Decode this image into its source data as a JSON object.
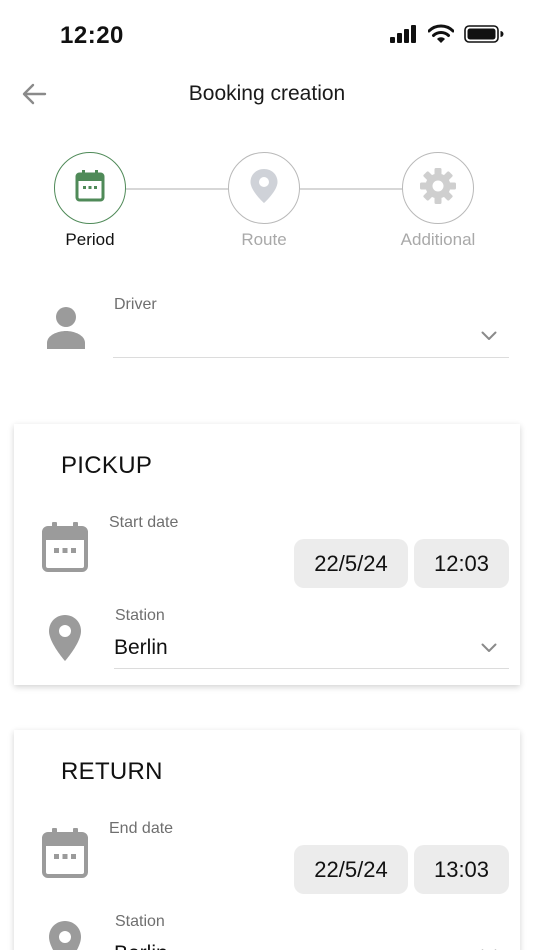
{
  "status_bar": {
    "time": "12:20"
  },
  "header": {
    "title": "Booking creation"
  },
  "stepper": {
    "steps": [
      {
        "label": "Period",
        "active": true
      },
      {
        "label": "Route",
        "active": false
      },
      {
        "label": "Additional",
        "active": false
      }
    ]
  },
  "driver": {
    "label": "Driver",
    "value": ""
  },
  "pickup": {
    "title": "PICKUP",
    "date_label": "Start date",
    "date": "22/5/24",
    "time": "12:03",
    "station_label": "Station",
    "station": "Berlin"
  },
  "return": {
    "title": "RETURN",
    "date_label": "End date",
    "date": "22/5/24",
    "time": "13:03",
    "station_label": "Station",
    "station": "Berlin"
  },
  "colors": {
    "active_step": "#4f8a58",
    "inactive_icon": "#cfd2d8",
    "chip_background": "#ececec",
    "icon_grey": "#9b9b9b"
  }
}
